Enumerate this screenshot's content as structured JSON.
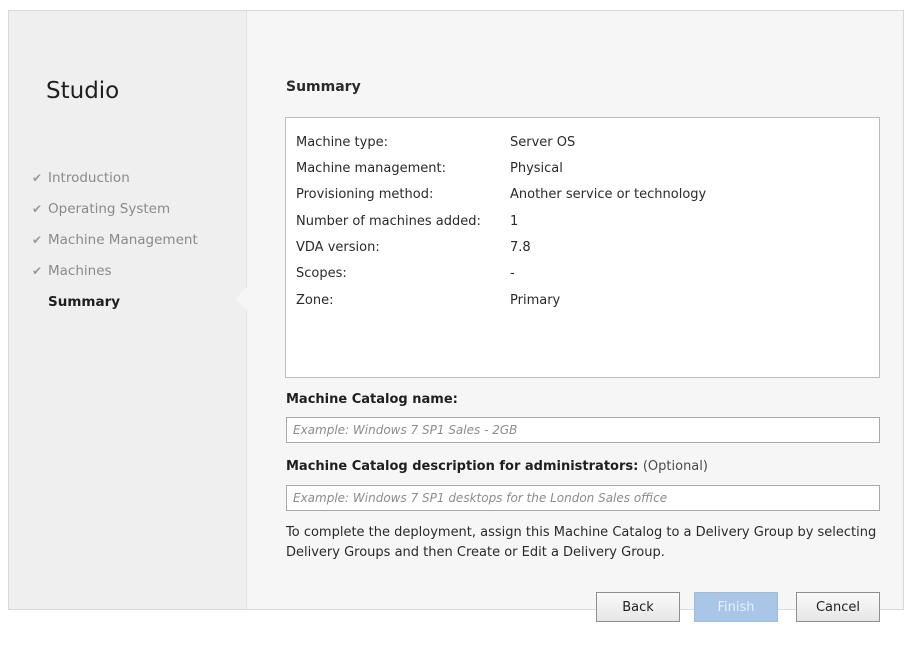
{
  "sidebar": {
    "app_title": "Studio",
    "steps": [
      {
        "label": "Introduction",
        "done": true
      },
      {
        "label": "Operating System",
        "done": true
      },
      {
        "label": "Machine Management",
        "done": true
      },
      {
        "label": "Machines",
        "done": true
      },
      {
        "label": "Summary",
        "done": false,
        "current": true
      }
    ],
    "check_icon": "✔"
  },
  "main": {
    "title": "Summary",
    "summary": [
      {
        "label": "Machine type:",
        "value": "Server OS"
      },
      {
        "label": "Machine management:",
        "value": "Physical"
      },
      {
        "label": "Provisioning method:",
        "value": "Another service or technology"
      },
      {
        "label": "Number of machines added:",
        "value": "1"
      },
      {
        "label": "VDA version:",
        "value": "7.8"
      },
      {
        "label": "Scopes:",
        "value": "-"
      },
      {
        "label": "Zone:",
        "value": "Primary"
      }
    ],
    "catalog_name_label": "Machine Catalog name:",
    "catalog_name_placeholder": "Example: Windows 7 SP1 Sales - 2GB",
    "catalog_name_value": "",
    "description_label": "Machine Catalog description for administrators:",
    "description_optional": "(Optional)",
    "description_placeholder": "Example: Windows 7 SP1 desktops for the London Sales office",
    "description_value": "",
    "hint": "To complete the deployment, assign this Machine Catalog to a Delivery Group by selecting Delivery Groups and then Create or Edit a Delivery Group."
  },
  "buttons": {
    "back": "Back",
    "finish": "Finish",
    "cancel": "Cancel"
  },
  "colors": {
    "finish_disabled": "#a9c6e6",
    "sidebar_bg": "#efefef",
    "content_bg": "#f6f6f6"
  }
}
